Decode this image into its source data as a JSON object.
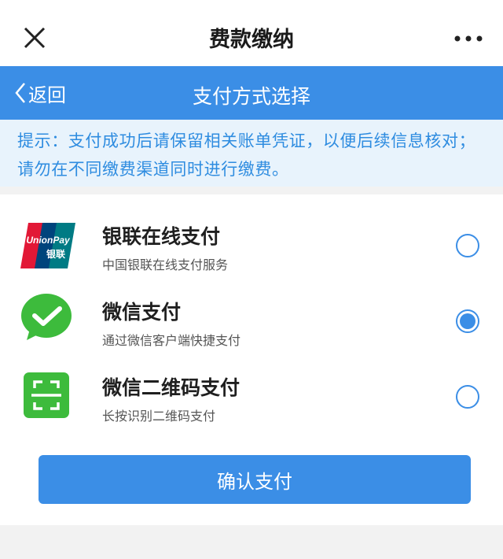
{
  "header": {
    "title": "费款缴纳",
    "close_icon": "close-icon",
    "more_icon": "more-icon"
  },
  "nav": {
    "back_label": "返回",
    "title": "支付方式选择"
  },
  "notice": {
    "text": "提示：支付成功后请保留相关账单凭证，以便后续信息核对；请勿在不同缴费渠道同时进行缴费。"
  },
  "payment_options": [
    {
      "title": "银联在线支付",
      "subtitle": "中国银联在线支付服务",
      "icon": "unionpay-icon",
      "logo_text_top": "UnionPay",
      "logo_text_bottom": "银联",
      "selected": false
    },
    {
      "title": "微信支付",
      "subtitle": "通过微信客户端快捷支付",
      "icon": "wechat-pay-icon",
      "selected": true
    },
    {
      "title": "微信二维码支付",
      "subtitle": "长按识别二维码支付",
      "icon": "qr-scan-icon",
      "selected": false
    }
  ],
  "confirm_label": "确认支付",
  "colors": {
    "primary": "#3b8ee6",
    "notice_bg": "#e8f3fc",
    "notice_text": "#2e8ce0",
    "wechat_green": "#3dbb3c"
  }
}
